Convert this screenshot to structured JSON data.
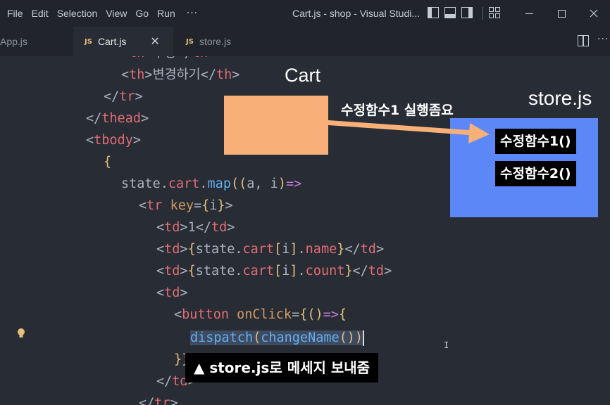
{
  "menu": {
    "items": [
      "File",
      "Edit",
      "Selection",
      "View",
      "Go",
      "Run"
    ],
    "more": "···"
  },
  "window_title": "Cart.js - shop - Visual Studi...",
  "tabs": [
    {
      "prefix": "",
      "label": "App.js"
    },
    {
      "prefix": "JS",
      "label": "Cart.js",
      "close": "✕"
    },
    {
      "prefix": "JS",
      "label": "store.js"
    }
  ],
  "editor": {
    "code_lines": [
      "<th>수량</th>",
      "<th>변경하기</th>",
      "</tr>",
      "</thead>",
      "<tbody>",
      "{",
      "state.cart.map((a, i)=>",
      "<tr key={i}>",
      "<td>1</td>",
      "<td>{state.cart[i].name}</td>",
      "<td>{state.cart[i].count}</td>",
      "<td>",
      "<button onClick={()=>{",
      "dispatch(changeName())",
      "}}",
      "</td>",
      "</tr>"
    ]
  },
  "diagram": {
    "cart_label": "Cart",
    "store_label": "store.js",
    "arrow_label": "수정함수1 실행좀요",
    "functions": [
      "수정함수1()",
      "수정함수2()"
    ],
    "caption": "▲ store.js로 메세지 보내줌",
    "colors": {
      "cart_box": "#f9b078",
      "store_box": "#5b87f7",
      "arrow": "#f9b078"
    }
  }
}
